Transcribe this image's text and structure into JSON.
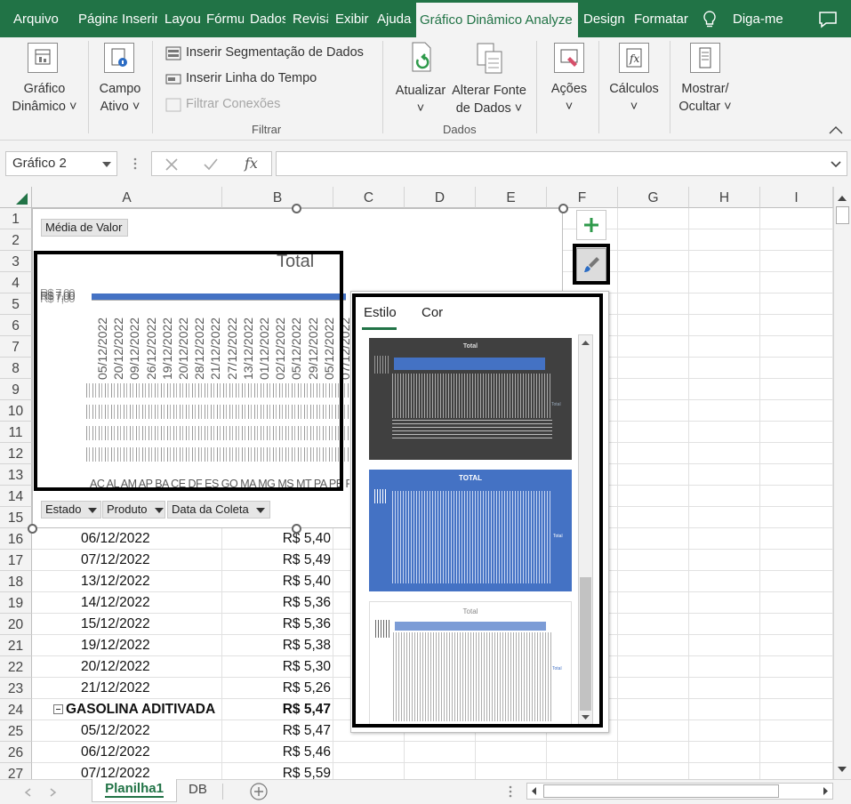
{
  "ribbon_tabs": [
    "Arquivo",
    "Página",
    "Inserir",
    "Layou",
    "Fórmu",
    "Dados",
    "Revisã",
    "Exibir",
    "Ajuda",
    "Gráfico Dinâmico Analyze",
    "Design",
    "Formatar"
  ],
  "tell_me": "Diga-me",
  "ribbon": {
    "grafico_dinamico": [
      "Gráfico",
      "Dinâmico ˅"
    ],
    "campo_ativo": [
      "Campo",
      "Ativo ˅"
    ],
    "filtrar": {
      "seg": "Inserir Segmentação de Dados",
      "linha": "Inserir Linha do Tempo",
      "conex": "Filtrar Conexões",
      "group": "Filtrar"
    },
    "atualizar": [
      "Atualizar",
      "˅"
    ],
    "alterar_fonte": [
      "Alterar Fonte",
      "de Dados ˅"
    ],
    "dados_group": "Dados",
    "acoes": [
      "Ações",
      "˅"
    ],
    "calculos": [
      "Cálculos",
      "˅"
    ],
    "mostrar": [
      "Mostrar/",
      "Ocultar ˅"
    ]
  },
  "formula_bar": {
    "name_box": "Gráfico 2",
    "fx": "fx"
  },
  "columns": [
    "A",
    "B",
    "C",
    "D",
    "E",
    "F",
    "G",
    "H",
    "I"
  ],
  "rows": [
    "1",
    "2",
    "3",
    "4",
    "5",
    "6",
    "7",
    "8",
    "9",
    "10",
    "11",
    "12",
    "13",
    "14",
    "15",
    "16",
    "17",
    "18",
    "19",
    "20",
    "21",
    "22",
    "23",
    "24",
    "25",
    "26",
    "27"
  ],
  "cells": [
    {
      "row": "16",
      "a": "06/12/2022",
      "b": "R$ 5,40"
    },
    {
      "row": "17",
      "a": "07/12/2022",
      "b": "R$ 5,49"
    },
    {
      "row": "18",
      "a": "13/12/2022",
      "b": "R$ 5,40"
    },
    {
      "row": "19",
      "a": "14/12/2022",
      "b": "R$ 5,36"
    },
    {
      "row": "20",
      "a": "15/12/2022",
      "b": "R$ 5,36"
    },
    {
      "row": "21",
      "a": "19/12/2022",
      "b": "R$ 5,38"
    },
    {
      "row": "22",
      "a": "20/12/2022",
      "b": "R$ 5,30"
    },
    {
      "row": "23",
      "a": "21/12/2022",
      "b": "R$ 5,26"
    },
    {
      "row": "24",
      "a": "GASOLINA ADITIVADA",
      "b": "R$ 5,47",
      "group": true
    },
    {
      "row": "25",
      "a": "05/12/2022",
      "b": "R$ 5,47"
    },
    {
      "row": "26",
      "a": "06/12/2022",
      "b": "R$ 5,46"
    },
    {
      "row": "27",
      "a": "07/12/2022",
      "b": "R$ 5,59"
    }
  ],
  "chart": {
    "value_button": "Média de Valor",
    "title": "Total",
    "y_label": "R$ 7,00",
    "dates": [
      "05/12/2022",
      "20/12/2022",
      "09/12/2022",
      "26/12/2022",
      "19/12/2022",
      "20/12/2022",
      "28/12/2022",
      "21/12/2022",
      "27/12/2022",
      "13/12/2022",
      "01/12/2022",
      "02/12/2022",
      "05/12/2022",
      "29/12/2022",
      "05/12/2022",
      "07/12/2022"
    ],
    "states": "AC AL AM AP BA CE DF ES GO MA MG MS MT PA PB PE PI PR",
    "filters": [
      "Estado",
      "Produto",
      "Data da Coleta"
    ]
  },
  "style_panel": {
    "tabs": [
      "Estilo",
      "Cor"
    ],
    "thumb_title": "Total",
    "thumb_title2": "TOTAL",
    "legend": "Total"
  },
  "sheets": [
    "Planilha1",
    "DB"
  ],
  "colors": {
    "excel_green": "#217346",
    "bar_blue": "#4472c4"
  }
}
